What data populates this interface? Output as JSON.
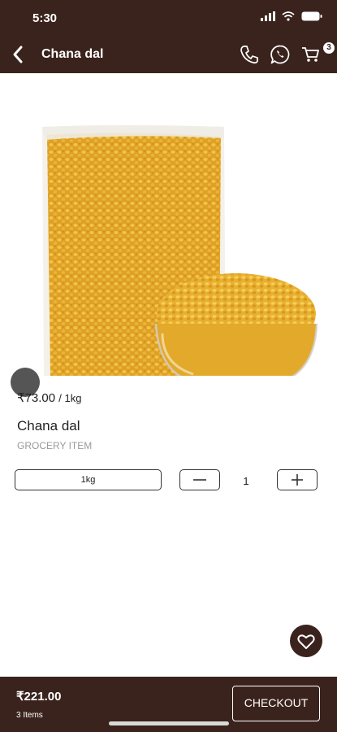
{
  "status_bar": {
    "time": "5:30"
  },
  "header": {
    "title": "Chana dal",
    "cart_count": "3"
  },
  "product": {
    "price": "₹73.00",
    "unit": "/ 1kg",
    "name": "Chana dal",
    "category": "GROCERY ITEM",
    "variant": "1kg",
    "quantity": "1"
  },
  "footer": {
    "total": "₹221.00",
    "items_count": "3 Items",
    "checkout_label": "CHECKOUT"
  },
  "colors": {
    "brand": "#3b231d",
    "dal": "#e3a92a"
  }
}
